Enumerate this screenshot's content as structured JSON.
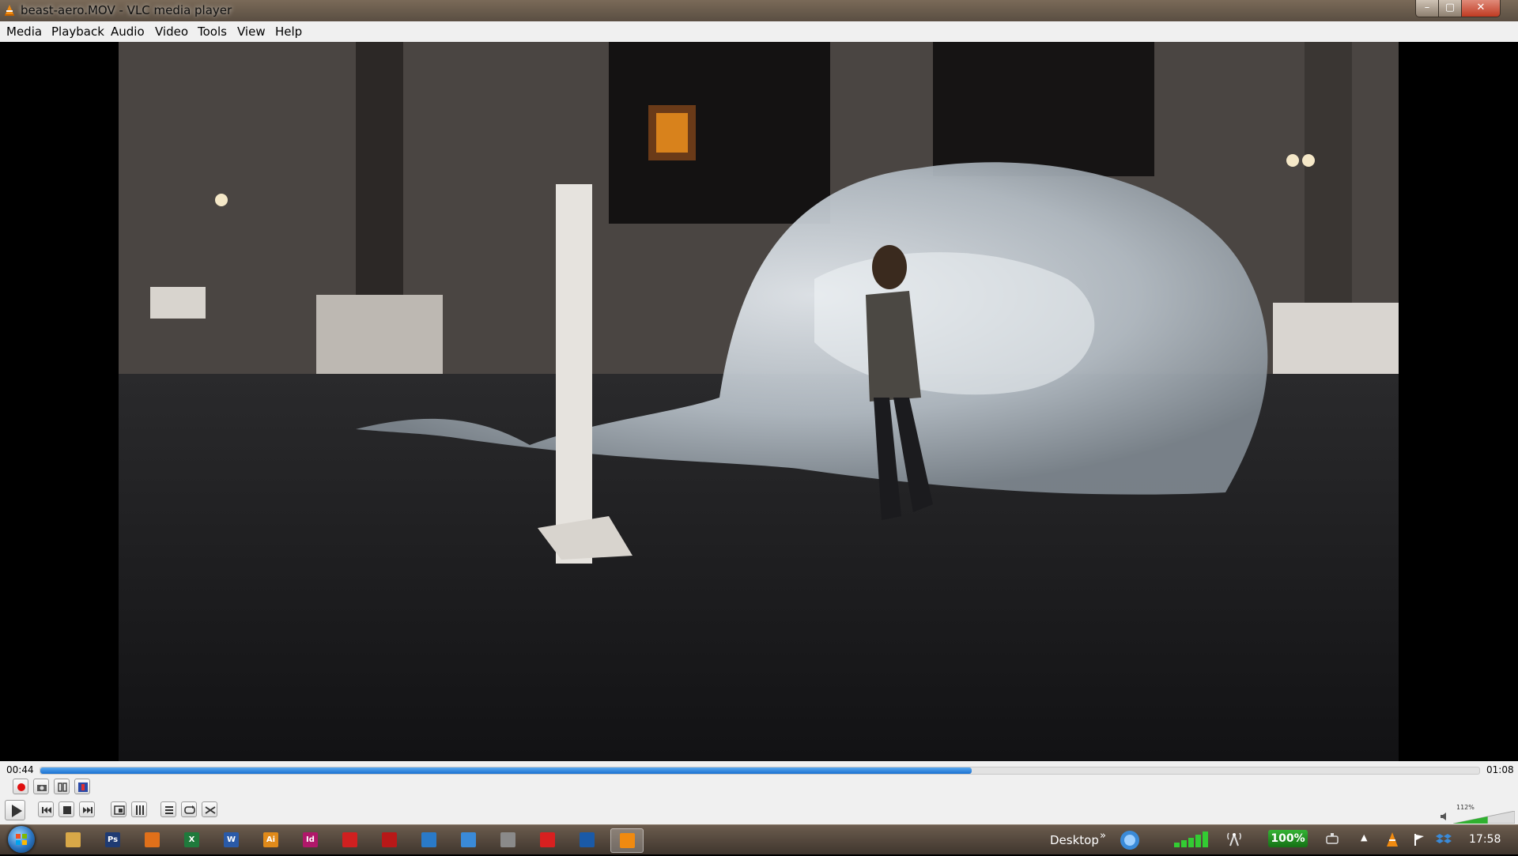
{
  "window": {
    "title": "beast-aero.MOV - VLC media player",
    "controls": {
      "minimize": "–",
      "maximize": "▢",
      "close": "✕"
    }
  },
  "menu": [
    "Media",
    "Playback",
    "Audio",
    "Video",
    "Tools",
    "View",
    "Help"
  ],
  "player": {
    "elapsed": "00:44",
    "total": "01:08",
    "progress_fraction": 0.647,
    "volume_label": "112%",
    "volume_fraction": 0.56
  },
  "controls": {
    "row1": [
      "record-icon",
      "snapshot-icon",
      "loop-ab-icon",
      "frame-step-icon"
    ],
    "row2": [
      "play-icon",
      "previous-icon",
      "stop-icon",
      "next-icon",
      "fullscreen-icon",
      "extended-settings-icon",
      "playlist-icon",
      "loop-icon",
      "shuffle-icon"
    ]
  },
  "taskbar": {
    "apps": [
      {
        "name": "explorer",
        "color": "#d8a848",
        "glyph": ""
      },
      {
        "name": "photoshop",
        "color": "#1f3b73",
        "glyph": "Ps"
      },
      {
        "name": "firefox",
        "color": "#e0701a",
        "glyph": ""
      },
      {
        "name": "excel",
        "color": "#1f7a3c",
        "glyph": "X"
      },
      {
        "name": "word",
        "color": "#2a5aa8",
        "glyph": "W"
      },
      {
        "name": "illustrator",
        "color": "#e08a1a",
        "glyph": "Ai"
      },
      {
        "name": "indesign",
        "color": "#b0186a",
        "glyph": "Id"
      },
      {
        "name": "acrobat",
        "color": "#d02020",
        "glyph": ""
      },
      {
        "name": "acrobat-pro",
        "color": "#b81818",
        "glyph": ""
      },
      {
        "name": "browser",
        "color": "#2a7ac8",
        "glyph": ""
      },
      {
        "name": "dropbox",
        "color": "#3a8ad8",
        "glyph": ""
      },
      {
        "name": "printer",
        "color": "#8a8a8a",
        "glyph": ""
      },
      {
        "name": "red-app",
        "color": "#d82020",
        "glyph": ""
      },
      {
        "name": "ccleaner",
        "color": "#1a5aa8",
        "glyph": ""
      },
      {
        "name": "vlc",
        "color": "#f08a10",
        "glyph": ""
      }
    ],
    "desktop_label": "Desktop",
    "desktop_chevron": "»",
    "battery_percent": "100%",
    "clock": "17:58"
  }
}
